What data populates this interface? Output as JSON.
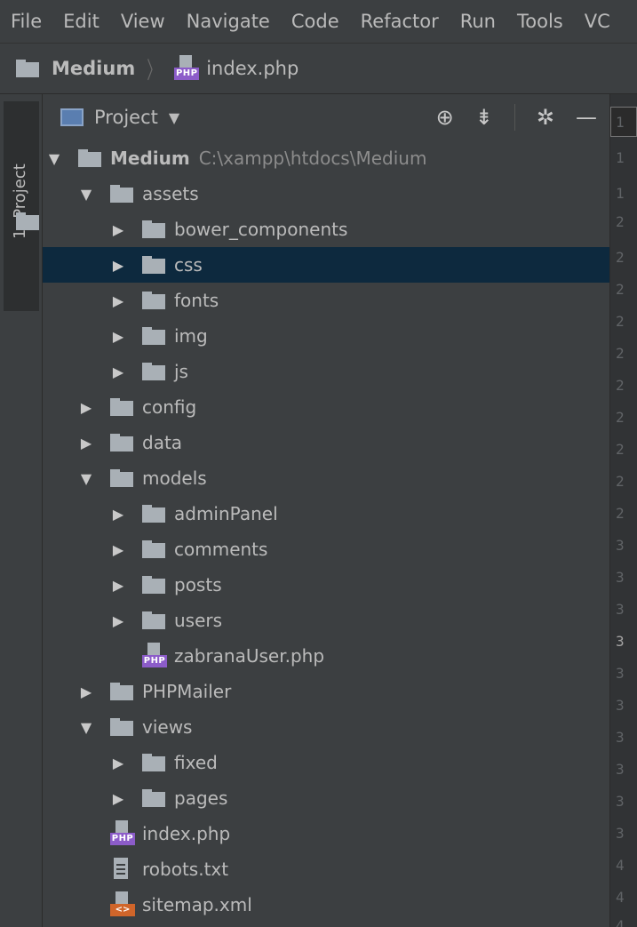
{
  "menubar": {
    "items": [
      {
        "label": "File"
      },
      {
        "label": "Edit"
      },
      {
        "label": "View"
      },
      {
        "label": "Navigate"
      },
      {
        "label": "Code"
      },
      {
        "label": "Refactor"
      },
      {
        "label": "Run"
      },
      {
        "label": "Tools"
      },
      {
        "label": "VC"
      }
    ]
  },
  "breadcrumb": {
    "project": "Medium",
    "file": "index.php"
  },
  "toolstrip": {
    "tab_label": "1: Project"
  },
  "panel": {
    "title": "Project",
    "dropdown_icon": "caret-down-icon",
    "tools": [
      "locate-icon",
      "collapse-icon",
      "gear-icon",
      "hide-icon"
    ]
  },
  "tree": {
    "root": {
      "name": "Medium",
      "path": "C:\\xampp\\htdocs\\Medium"
    },
    "rows": [
      {
        "name": "assets"
      },
      {
        "name": "bower_components"
      },
      {
        "name": "css"
      },
      {
        "name": "fonts"
      },
      {
        "name": "img"
      },
      {
        "name": "js"
      },
      {
        "name": "config"
      },
      {
        "name": "data"
      },
      {
        "name": "models"
      },
      {
        "name": "adminPanel"
      },
      {
        "name": "comments"
      },
      {
        "name": "posts"
      },
      {
        "name": "users"
      },
      {
        "name": "zabranaUser.php"
      },
      {
        "name": "PHPMailer"
      },
      {
        "name": "views"
      },
      {
        "name": "fixed"
      },
      {
        "name": "pages"
      },
      {
        "name": "index.php"
      },
      {
        "name": "robots.txt"
      },
      {
        "name": "sitemap.xml"
      }
    ]
  },
  "badges": {
    "php": "PHP",
    "xml": "<>"
  },
  "gutter": {
    "lines": [
      "1",
      "1",
      "1",
      "2",
      "2",
      "2",
      "2",
      "2",
      "2",
      "2",
      "2",
      "2",
      "2",
      "3",
      "3",
      "3",
      "3",
      "3",
      "3",
      "3",
      "3",
      "3",
      "3",
      "4",
      "4",
      "4"
    ]
  }
}
